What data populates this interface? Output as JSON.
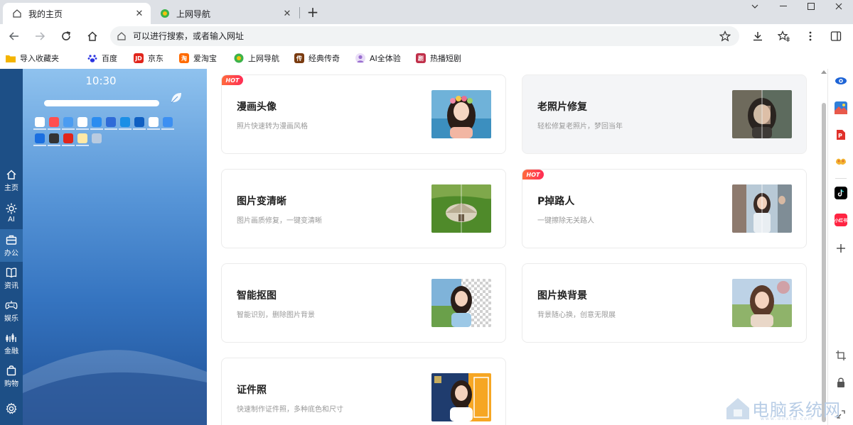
{
  "tabs": [
    {
      "title": "我的主页",
      "active": true,
      "icon": "home-outline-icon"
    },
    {
      "title": "上网导航",
      "active": false,
      "icon": "nav-globe-icon"
    }
  ],
  "toolbar": {
    "address_placeholder": "可以进行搜索，或者输入网址"
  },
  "bookmarks": [
    {
      "label": "导入收藏夹",
      "icon": "folder-icon",
      "color": "#f4b400"
    },
    {
      "label": "百度",
      "icon": "baidu-paw-icon",
      "color": "#2932e1"
    },
    {
      "label": "京东",
      "icon": "jd-icon",
      "color": "#e1251b"
    },
    {
      "label": "爱淘宝",
      "icon": "taobao-icon",
      "color": "#ff6a00"
    },
    {
      "label": "上网导航",
      "icon": "nav-globe-icon",
      "color": "#3cb34a"
    },
    {
      "label": "经典传奇",
      "icon": "game-icon",
      "color": "#7a3b10"
    },
    {
      "label": "AI全体验",
      "icon": "ai-avatar-icon",
      "color": "#9a6fd0"
    },
    {
      "label": "热播短剧",
      "icon": "drama-icon",
      "color": "#c0304a"
    }
  ],
  "left_nav": [
    {
      "label": "主页",
      "icon": "home-icon",
      "active": false
    },
    {
      "label": "AI",
      "icon": "ai-gear-icon",
      "active": false
    },
    {
      "label": "办公",
      "icon": "briefcase-icon",
      "active": true
    },
    {
      "label": "资讯",
      "icon": "book-icon",
      "active": false
    },
    {
      "label": "娱乐",
      "icon": "gamepad-icon",
      "active": false
    },
    {
      "label": "金融",
      "icon": "chart-icon",
      "active": false
    },
    {
      "label": "购物",
      "icon": "bag-icon",
      "active": false
    },
    {
      "label": "",
      "icon": "settings-icon",
      "active": false
    }
  ],
  "preview": {
    "clock": "10:30"
  },
  "cards": [
    {
      "title": "漫画头像",
      "desc": "照片快速转为漫画风格",
      "hot": true,
      "thumb": "anime-portrait"
    },
    {
      "title": "老照片修复",
      "desc": "轻松修复老照片，梦回当年",
      "hot": false,
      "thumb": "old-photo"
    },
    {
      "title": "图片变清晰",
      "desc": "图片画质修复，一键变清晰",
      "hot": false,
      "thumb": "yurt-landscape"
    },
    {
      "title": "P掉路人",
      "desc": "一键擦除无关路人",
      "hot": true,
      "thumb": "street-girl"
    },
    {
      "title": "智能抠图",
      "desc": "智能识别，删除图片背景",
      "hot": false,
      "thumb": "cutout-girl"
    },
    {
      "title": "图片换背景",
      "desc": "背景随心换，创意无限展",
      "hot": false,
      "thumb": "background-girl"
    },
    {
      "title": "证件照",
      "desc": "快速制作证件照，多种底色和尺寸",
      "hot": false,
      "thumb": "id-photo"
    }
  ],
  "hot_label": "HOT",
  "right_sidebar": [
    "sparkle-eye-icon",
    "landscape-app-icon",
    "pdf-tool-icon",
    "hands-app-icon",
    "tiktok-icon",
    "xiaohongshu-icon",
    "plus-icon",
    "crop-icon",
    "lock-icon",
    "expand-icon"
  ],
  "xiaohongshu_label": "小红书",
  "watermark": {
    "text": "电脑系统网",
    "url": "www.dnxtw.com"
  }
}
